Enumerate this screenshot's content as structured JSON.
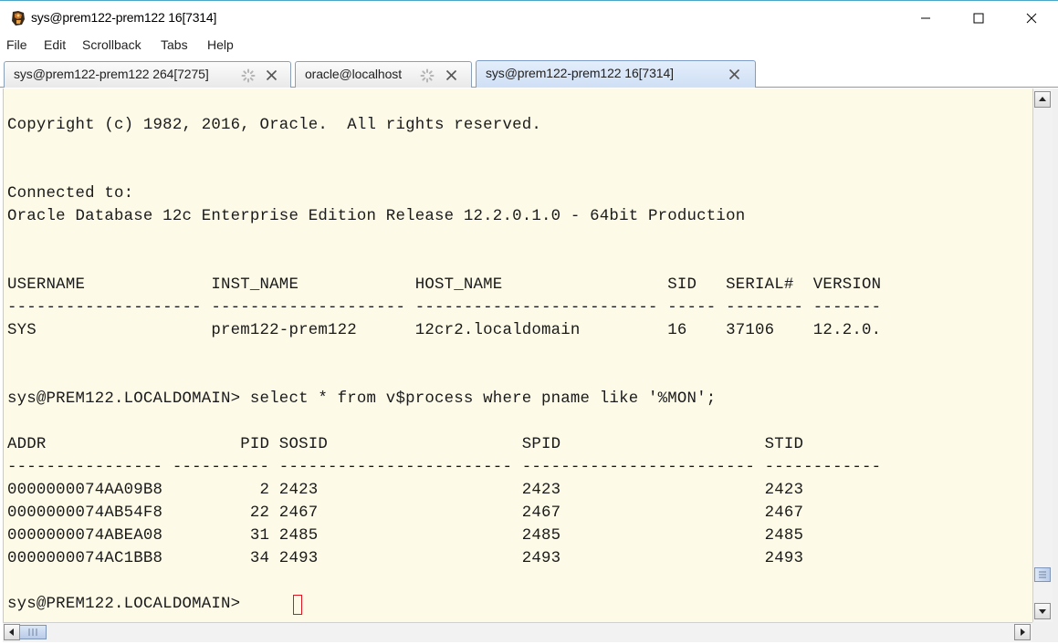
{
  "window": {
    "title": "sys@prem122-prem122 16[7314]",
    "app_icon": "terminal-app-icon"
  },
  "menu": [
    "File",
    "Edit",
    "Scrollback",
    "Tabs",
    "Help"
  ],
  "tabs": [
    {
      "label": "sys@prem122-prem122 264[7275]",
      "busy": true,
      "active": false
    },
    {
      "label": "oracle@localhost",
      "busy": true,
      "active": false
    },
    {
      "label": "sys@prem122-prem122 16[7314]",
      "busy": false,
      "active": true
    }
  ],
  "terminal": {
    "lines": [
      "Copyright (c) 1982, 2016, Oracle.  All rights reserved.",
      "Connected to:",
      "Oracle Database 12c Enterprise Edition Release 12.2.0.1.0 - 64bit Production",
      "USERNAME             INST_NAME            HOST_NAME                 SID   SERIAL#  VERSION",
      "-------------------- -------------------- ------------------------- ----- -------- -------",
      "SYS                  prem122-prem122      12cr2.localdomain         16    37106    12.2.0.",
      "sys@PREM122.LOCALDOMAIN> select * from v$process where pname like '%MON';",
      "ADDR                    PID SOSID                    SPID                     STID",
      "---------------- ---------- ------------------------ ------------------------ ------------",
      "0000000074AA09B8          2 2423                     2423                     2423",
      "0000000074AB54F8         22 2467                     2467                     2467",
      "0000000074ABEA08         31 2485                     2485                     2485",
      "0000000074AC1BB8         34 2493                     2493                     2493",
      "sys@PREM122.LOCALDOMAIN> "
    ],
    "cursor_color": "#e0141e",
    "background": "#fdfbe8"
  }
}
